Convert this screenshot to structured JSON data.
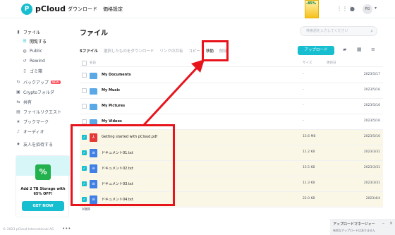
{
  "header": {
    "logo_letter": "P",
    "logo_text": "pCloud",
    "nav": [
      "ダウンロード",
      "価格設定"
    ],
    "promo_text": "-85%",
    "avatar_initials": "PG"
  },
  "sidebar": {
    "items": [
      {
        "label": "ファイル",
        "icon": "file-icon"
      },
      {
        "label": "閲覧する",
        "icon": "list-icon"
      },
      {
        "label": "Public",
        "icon": "globe-icon"
      },
      {
        "label": "Rewind",
        "icon": "rewind-icon"
      },
      {
        "label": "ゴミ箱",
        "icon": "trash-icon"
      },
      {
        "label": "バックアップ",
        "icon": "backup-icon",
        "badge": "NEW"
      },
      {
        "label": "Cryptoフォルダ",
        "icon": "lock-icon"
      },
      {
        "label": "共有",
        "icon": "share-icon"
      },
      {
        "label": "ファイルリクエスト",
        "icon": "request-icon"
      },
      {
        "label": "ブックマーク",
        "icon": "star-icon"
      },
      {
        "label": "オーディオ",
        "icon": "audio-icon"
      },
      {
        "label": "友人を招待する",
        "icon": "gift-icon"
      }
    ],
    "promo": {
      "icon_text": "%",
      "line1": "Add 2 TB Storage with",
      "line2": "65% OFF!",
      "button": "GET NOW"
    },
    "copyright": "© 2023 pCloud International AG",
    "more": "•••"
  },
  "main": {
    "title": "ファイル",
    "search_placeholder": "検索語を入力してください",
    "toolbar": {
      "count": "5ファイル",
      "download": "選択したものをダウンロード",
      "link_share": "リンクの共有",
      "copy": "コピー",
      "move": "移動",
      "delete": "削除",
      "upload": "アップロード"
    },
    "columns": {
      "name": "名前",
      "size": "サイズ",
      "modified": "更新日"
    },
    "rows": [
      {
        "type": "folder",
        "name": "My Documents",
        "size": "-",
        "date": "2023/5/17",
        "selected": false
      },
      {
        "type": "folder",
        "name": "My Music",
        "size": "-",
        "date": "2023/5/16",
        "selected": false
      },
      {
        "type": "folder",
        "name": "My Pictures",
        "size": "-",
        "date": "2023/5/16",
        "selected": false
      },
      {
        "type": "folder",
        "name": "My Videos",
        "size": "-",
        "date": "2023/5/16",
        "selected": false
      },
      {
        "type": "pdf",
        "name": "Getting started with pCloud.pdf",
        "size": "15.6 MB",
        "date": "2023/5/16",
        "selected": true
      },
      {
        "type": "doc",
        "name": "ドキュメント01.txt",
        "size": "11.2 KB",
        "date": "2023/3/31",
        "selected": true
      },
      {
        "type": "doc",
        "name": "ドキュメント02.txt",
        "size": "15.5 KB",
        "date": "2023/3/31",
        "selected": true
      },
      {
        "type": "doc",
        "name": "ドキュメント03.txt",
        "size": "11.3 KB",
        "date": "2023/3/31",
        "selected": true
      },
      {
        "type": "doc",
        "name": "ドキュメント04.txt",
        "size": "22.0 KB",
        "date": "2023/4/4",
        "selected": true
      }
    ],
    "footer_count": "9項目"
  },
  "upload_manager": {
    "title": "アップロードマネージャー",
    "subtitle": "有効なアップロードはありません"
  },
  "colors": {
    "accent": "#17bed0",
    "annotation": "#e8141c",
    "selected_row": "#fbf7e6"
  }
}
